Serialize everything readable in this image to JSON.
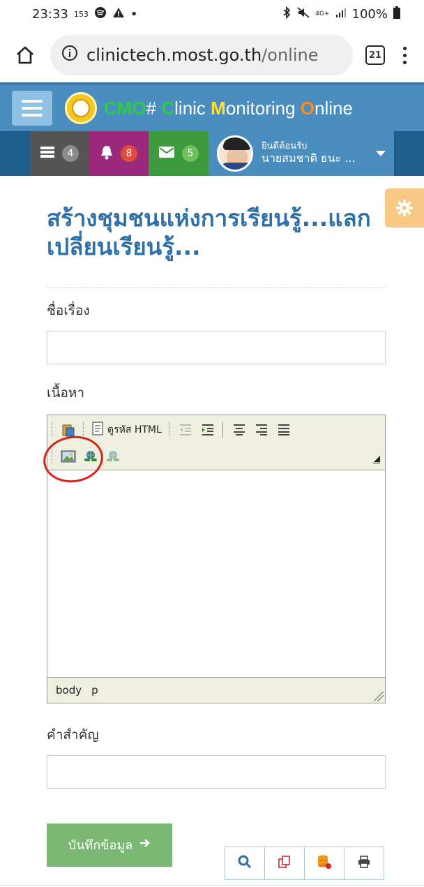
{
  "status": {
    "time": "23:33",
    "small_num": "153",
    "battery": "100%",
    "net": "4G+"
  },
  "browser": {
    "url_domain": "clinictech.most.go.th",
    "url_path": "/online",
    "tabs_count": "21"
  },
  "header": {
    "brand_parts": [
      "CMO",
      "# ",
      "C",
      "linic ",
      "M",
      "onitoring ",
      "O",
      "nline"
    ]
  },
  "notifications": {
    "tasks_count": "4",
    "alerts_count": "8",
    "messages_count": "5"
  },
  "user": {
    "welcome": "ยินดีต้อนรับ",
    "name": "นายสมชาติ ธนะ ..."
  },
  "page": {
    "title": "สร้างชุมชนแห่งการเรียนรู้...แลกเปลี่ยนเรียนรู้...",
    "subject_label": "ชื่อเรื่อง",
    "content_label": "เนื้อหา",
    "keyword_label": "คำสำคัญ",
    "subject_value": "",
    "keyword_value": ""
  },
  "editor": {
    "html_button": "ดูรหัส HTML",
    "status_path": [
      "body",
      "p"
    ]
  },
  "actions": {
    "save_label": "บันทึกข้อมูล"
  },
  "colors": {
    "header": "#4a8dbf",
    "title": "#2d6fa6",
    "save": "#7ab874",
    "annotation": "#d9231a"
  }
}
